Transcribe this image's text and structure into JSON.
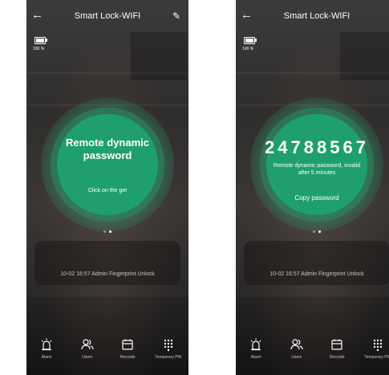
{
  "header": {
    "title": "Smart Lock-WIFI",
    "back_icon": "arrow-left-icon",
    "edit_icon": "pencil-icon"
  },
  "battery": {
    "label": "100 %"
  },
  "left": {
    "circle_title_line1": "Remote dynamic",
    "circle_title_line2": "password",
    "circle_action": "Click on the get"
  },
  "right": {
    "code": "24788567",
    "hint_line1": "Remote dynamic password, invalid",
    "hint_line2": "after 5 minutes",
    "circle_action": "Copy password"
  },
  "record_text": "10-02 16:57  Admin Fingerprint Unlock",
  "tabs": [
    {
      "label": "Alarm",
      "icon": "alarm-icon"
    },
    {
      "label": "Users",
      "icon": "users-icon"
    },
    {
      "label": "Records",
      "icon": "calendar-icon"
    },
    {
      "label": "Temporary PW",
      "icon": "keypad-icon"
    }
  ],
  "colors": {
    "accent": "#1fa06a",
    "background": "#333130"
  }
}
